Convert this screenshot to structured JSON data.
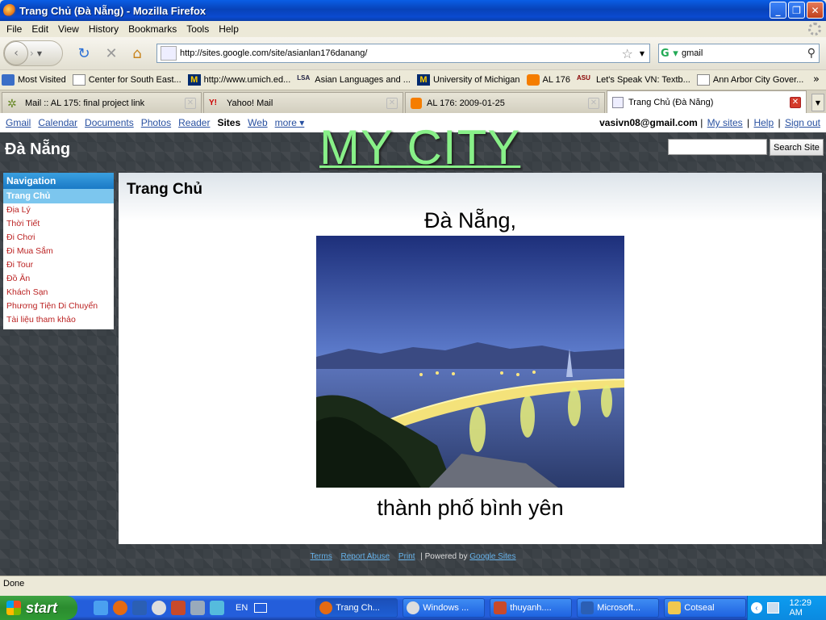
{
  "window": {
    "title": "Trang Chủ (Đà Nẵng) - Mozilla Firefox"
  },
  "menu": [
    "File",
    "Edit",
    "View",
    "History",
    "Bookmarks",
    "Tools",
    "Help"
  ],
  "urlbar": {
    "url": "http://sites.google.com/site/asianlan176danang/"
  },
  "searchbar": {
    "value": "gmail"
  },
  "bookmarks": [
    {
      "label": "Most Visited",
      "icon": "folder-icon"
    },
    {
      "label": "Center for South East...",
      "icon": "page-icon"
    },
    {
      "label": "http://www.umich.ed...",
      "icon": "umich-icon"
    },
    {
      "label": "Asian Languages and ...",
      "icon": "lsa-icon"
    },
    {
      "label": "University of Michigan",
      "icon": "umich-icon"
    },
    {
      "label": "AL 176",
      "icon": "blogger-icon"
    },
    {
      "label": "Let's Speak VN: Textb...",
      "icon": "asu-icon"
    },
    {
      "label": "Ann Arbor City Gover...",
      "icon": "page-icon"
    }
  ],
  "tabs": [
    {
      "label": "Mail :: AL 175: final project link",
      "active": false
    },
    {
      "label": "Yahoo! Mail",
      "active": false
    },
    {
      "label": "AL 176: 2009-01-25",
      "active": false
    },
    {
      "label": "Trang Chủ (Đà Nẵng)",
      "active": true
    }
  ],
  "gbar": {
    "links": [
      "Gmail",
      "Calendar",
      "Documents",
      "Photos",
      "Reader"
    ],
    "current": "Sites",
    "links2": [
      "Web"
    ],
    "more": "more ▾",
    "account": "vasivn08@gmail.com",
    "my_sites": "My sites",
    "help": "Help",
    "sign_out": "Sign out"
  },
  "site": {
    "name": "Đà Nẵng",
    "banner": "MY CITY",
    "search_button": "Search Site"
  },
  "navigation": {
    "header": "Navigation",
    "selected": "Trang Chủ",
    "items": [
      "Địa Lý",
      "Thời Tiết",
      "Đi Chơi",
      "Đi Mua Sắm",
      "Đi Tour",
      "Đồ Ăn",
      "Khách Sạn",
      "Phương Tiện Di Chuyển",
      "Tài liệu tham khảo"
    ]
  },
  "content": {
    "page_title": "Trang Chủ",
    "heading1": "Đà Nẵng,",
    "heading2": "thành phố bình yên"
  },
  "footer": {
    "terms": "Terms",
    "report": "Report Abuse",
    "print": "Print",
    "sep": "|",
    "powered": "Powered by",
    "google_sites": "Google Sites"
  },
  "status": "Done",
  "taskbar": {
    "start": "start",
    "lang": "EN",
    "tasks": [
      "Trang Ch...",
      "Windows ...",
      "thuyanh....",
      "Microsoft...",
      "Cotseal"
    ],
    "clock": "12:29 AM"
  },
  "colors": {
    "banner": "#88f088",
    "nav_link": "#b22222",
    "gbar_link": "#2850a0"
  }
}
